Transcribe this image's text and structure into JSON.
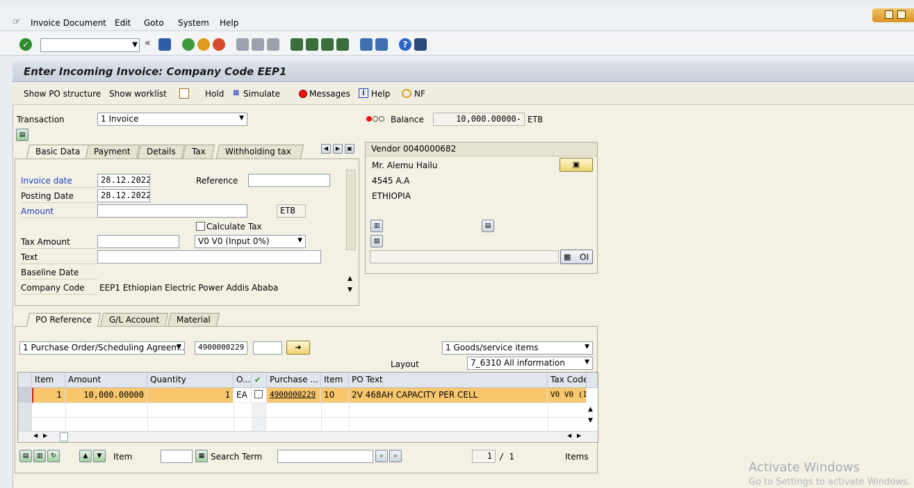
{
  "menu": {
    "items": [
      "Invoice Document",
      "Edit",
      "Goto",
      "System",
      "Help"
    ]
  },
  "toolbar": {
    "command_value": "",
    "icons": [
      "enter-icon",
      "back-icon",
      "save-icon",
      "exit-icon",
      "cancel-icon",
      "print-icon",
      "find-icon",
      "find-next-icon",
      "first-page-icon",
      "prev-page-icon",
      "next-page-icon",
      "last-page-icon",
      "create-session-icon",
      "shortcut-icon",
      "help-icon",
      "customize-icon"
    ]
  },
  "title": "Enter Incoming Invoice: Company Code EEP1",
  "appbar": {
    "show_po_structure": "Show PO structure",
    "show_worklist": "Show worklist",
    "hold": "Hold",
    "simulate": "Simulate",
    "messages": "Messages",
    "help": "Help",
    "nf": "NF"
  },
  "header": {
    "transaction_label": "Transaction",
    "transaction_value": "1 Invoice",
    "balance_label": "Balance",
    "balance_value": "10,000.00000-",
    "balance_currency": "ETB"
  },
  "tabs_top": [
    "Basic Data",
    "Payment",
    "Details",
    "Tax",
    "Withholding tax"
  ],
  "basic_data": {
    "invoice_date_label": "Invoice date",
    "invoice_date": "28.12.2022",
    "reference_label": "Reference",
    "reference_value": "",
    "posting_date_label": "Posting Date",
    "posting_date": "28.12.2022",
    "amount_label": "Amount",
    "amount_value": "",
    "amount_currency": "ETB",
    "calculate_tax_label": "Calculate Tax",
    "tax_amount_label": "Tax Amount",
    "tax_amount_value": "",
    "tax_code": "V0 V0 (Input 0%)",
    "text_label": "Text",
    "text_value": "",
    "baseline_date_label": "Baseline Date",
    "company_code_label": "Company Code",
    "company_code_value": "EEP1 Ethiopian Electric Power Addis Ababa"
  },
  "vendor": {
    "title": "Vendor 0040000682",
    "name": "Mr. Alemu Hailu",
    "address1": "4545 A.A",
    "country": "ETHIOPIA",
    "oi_label": "OI"
  },
  "tabs_bottom": [
    "PO Reference",
    "G/L Account",
    "Material"
  ],
  "po_ref": {
    "doc_type": "1 Purchase Order/Scheduling Agreem...",
    "po_number": "4900000229",
    "po_item": "",
    "items_type": "1 Goods/service items",
    "layout_label": "Layout",
    "layout_value": "7_6310 All information"
  },
  "table": {
    "columns": [
      "Item",
      "Amount",
      "Quantity",
      "O...",
      "",
      "Purchase ...",
      "Item",
      "PO Text",
      "Tax Code"
    ],
    "rows": [
      {
        "item": "1",
        "amount": "10,000.00000",
        "quantity": "1",
        "unit": "EA",
        "checked": "",
        "po": "4900000229",
        "po_item": "10",
        "po_text": "2V 468AH CAPACITY PER CELL",
        "tax_code": "V0 V0 (I"
      }
    ]
  },
  "footer": {
    "item_label": "Item",
    "item_value": "",
    "search_term_label": "Search Term",
    "search_term_value": "",
    "page_current": "1",
    "page_sep": "/ 1",
    "items_label": "Items"
  },
  "watermark": {
    "line1": "Activate Windows",
    "line2": "Go to Settings to activate Windows."
  },
  "colors": {
    "title_bg": "#c7d1dc",
    "row_highlight": "#f7c66d",
    "panel_bg": "#f3f0e4",
    "label_blue": "#1f3fbf"
  }
}
